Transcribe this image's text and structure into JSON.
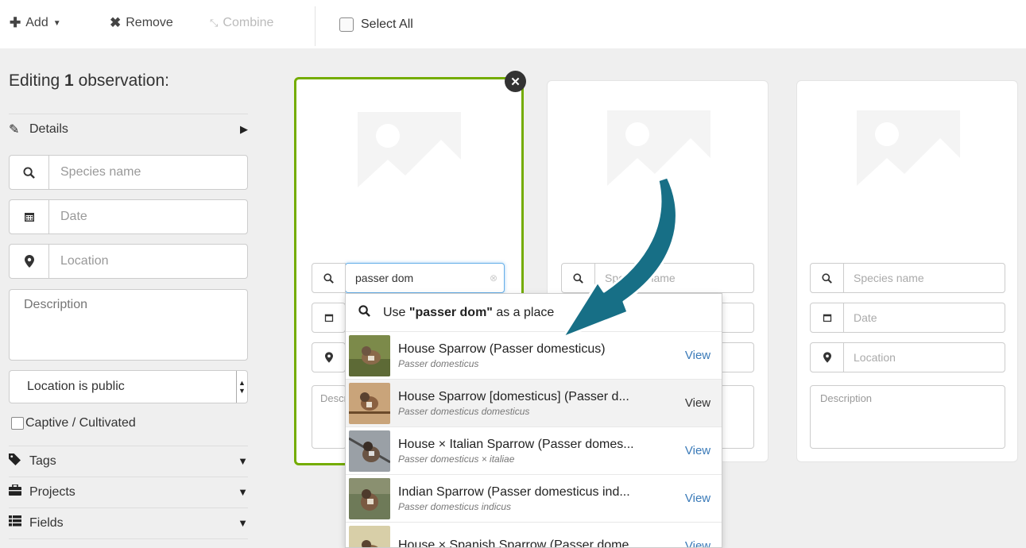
{
  "toolbar": {
    "add_label": "Add",
    "remove_label": "Remove",
    "combine_label": "Combine",
    "select_all_label": "Select All"
  },
  "sidebar": {
    "title_prefix": "Editing ",
    "title_count": "1",
    "title_suffix": " observation:",
    "details_label": "Details",
    "species_placeholder": "Species name",
    "date_placeholder": "Date",
    "location_placeholder": "Location",
    "description_placeholder": "Description",
    "location_privacy": "Location is public",
    "captive_label": "Captive / Cultivated",
    "sections": [
      {
        "label": "Tags"
      },
      {
        "label": "Projects"
      },
      {
        "label": "Fields"
      }
    ]
  },
  "cards": [
    {
      "species_value": "passer dom",
      "description_placeholder": "Description",
      "selected": true
    },
    {
      "species_placeholder": "Species name",
      "selected": false
    },
    {
      "species_placeholder": "Species name",
      "date_placeholder": "Date",
      "location_placeholder": "Location",
      "description_placeholder": "Description",
      "selected": false
    }
  ],
  "autocomplete": {
    "place_prefix": "Use ",
    "place_query": "\"passer dom\"",
    "place_suffix": " as a place",
    "view_label": "View",
    "items": [
      {
        "name": "House Sparrow (Passer domesticus)",
        "sci": "Passer domesticus"
      },
      {
        "name": "House Sparrow [domesticus] (Passer d...",
        "sci": "Passer domesticus domesticus"
      },
      {
        "name": "House × Italian Sparrow (Passer domes...",
        "sci": "Passer domesticus × italiae"
      },
      {
        "name": "Indian Sparrow (Passer domesticus ind...",
        "sci": "Passer domesticus indicus"
      },
      {
        "name": "House × Spanish Sparrow (Passer dome...",
        "sci": ""
      }
    ]
  },
  "colors": {
    "selected_border": "#74ac00",
    "link_blue": "#3a7ab8",
    "arrow_teal": "#176f86",
    "background": "#efefef"
  }
}
